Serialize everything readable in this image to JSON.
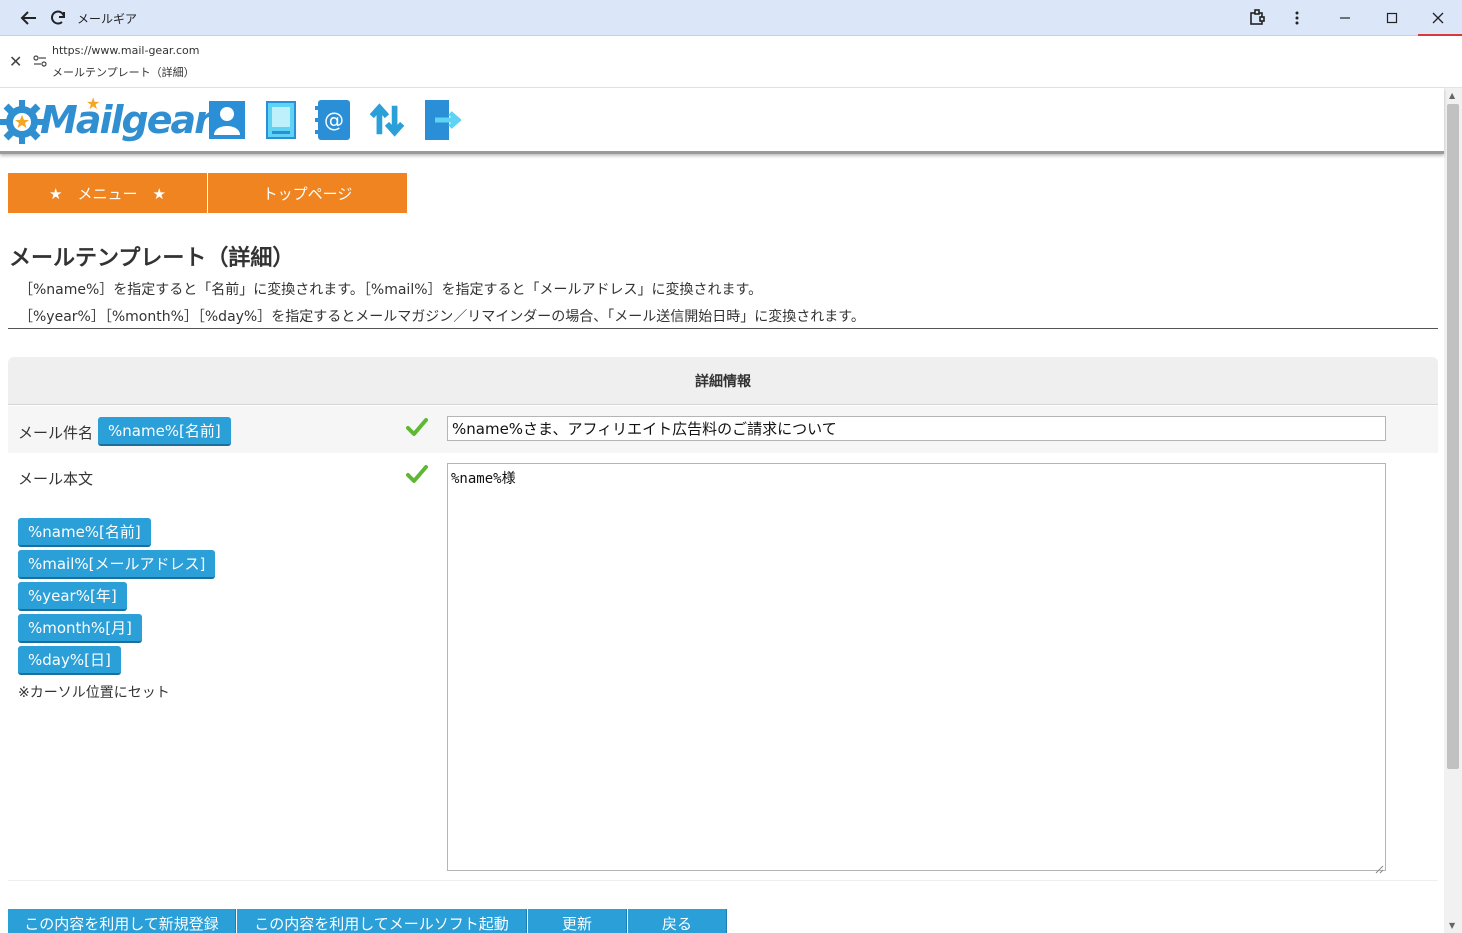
{
  "window": {
    "app_title": "メールギア",
    "url": "https://www.mail-gear.com",
    "page_title": "メールテンプレート（詳細）"
  },
  "header": {
    "logo_text": "Mailgear"
  },
  "menu": {
    "menu_label": "★　メニュー　★",
    "top_label": "トップページ"
  },
  "page": {
    "heading": "メールテンプレート（詳細）",
    "note1": "［%name%］を指定すると「名前」に変換されます。［%mail%］を指定すると「メールアドレス」に変換されます。",
    "note2": "［%year%］［%month%］［%day%］を指定するとメールマガジン／リマインダーの場合、「メール送信開始日時」に変換されます。"
  },
  "detail": {
    "section_title": "詳細情報",
    "subject_label": "メール件名",
    "subject_tag": "%name%[名前]",
    "subject_value": "%name%さま、アフィリエイト広告料のご請求について",
    "body_label": "メール本文",
    "body_value": "%name%様",
    "tags": [
      "%name%[名前]",
      "%mail%[メールアドレス]",
      "%year%[年]",
      "%month%[月]",
      "%day%[日]"
    ],
    "cursor_note": "※カーソル位置にセット"
  },
  "actions": {
    "new_register": "この内容を利用して新規登録",
    "launch_mailer": "この内容を利用してメールソフト起動",
    "update": "更新",
    "back": "戻る"
  },
  "colors": {
    "orange": "#ef8420",
    "tag_blue": "#2a9fd8",
    "check_green": "#5fb832"
  }
}
